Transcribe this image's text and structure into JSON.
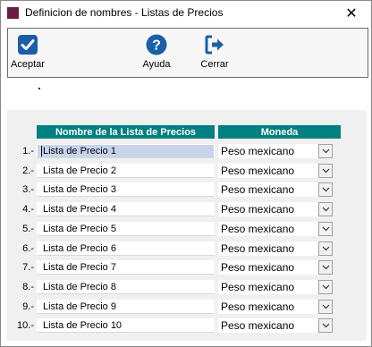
{
  "window": {
    "title": "Definicion de nombres - Listas de Precios",
    "close_glyph": "✕",
    "app_icon": "square-app-icon"
  },
  "toolbar": {
    "accept_label": "Aceptar",
    "help_label": "Ayuda",
    "close_label": "Cerrar",
    "accept_icon": "check-icon",
    "help_icon": "help-icon",
    "close_icon": "exit-icon",
    "icon_color": "#1a5fa8"
  },
  "grid": {
    "header_color": "#008080",
    "col_name_header": "Nombre de la Lista de Precios",
    "col_currency_header": "Moneda",
    "rows": [
      {
        "num": "1.-",
        "name": "Lista de Precio 1",
        "currency": "Peso mexicano",
        "selected": true
      },
      {
        "num": "2.-",
        "name": "Lista de Precio 2",
        "currency": "Peso mexicano"
      },
      {
        "num": "3.-",
        "name": "Lista de Precio 3",
        "currency": "Peso mexicano"
      },
      {
        "num": "4.-",
        "name": "Lista de Precio 4",
        "currency": "Peso mexicano"
      },
      {
        "num": "5.-",
        "name": "Lista de Precio 5",
        "currency": "Peso mexicano"
      },
      {
        "num": "6.-",
        "name": "Lista de Precio 6",
        "currency": "Peso mexicano"
      },
      {
        "num": "7.-",
        "name": "Lista de Precio 7",
        "currency": "Peso mexicano"
      },
      {
        "num": "8.-",
        "name": "Lista de Precio 8",
        "currency": "Peso mexicano"
      },
      {
        "num": "9.-",
        "name": "Lista de Precio 9",
        "currency": "Peso mexicano"
      },
      {
        "num": "10.-",
        "name": "Lista de Precio 10",
        "currency": "Peso mexicano"
      }
    ]
  }
}
